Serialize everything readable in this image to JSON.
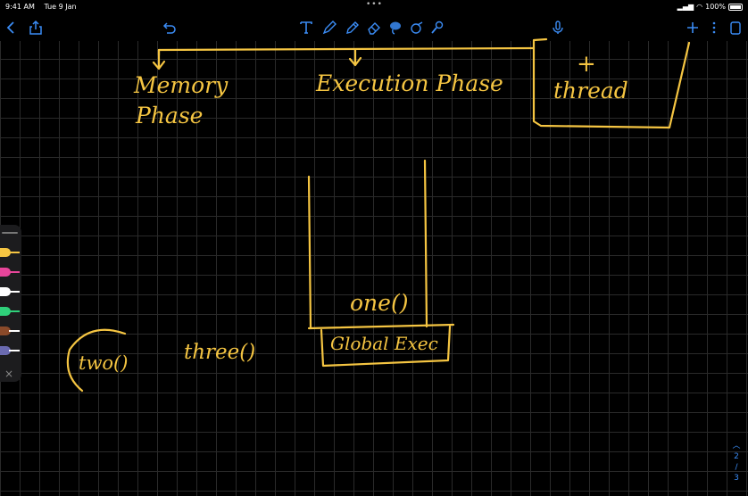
{
  "status": {
    "time": "9:41 AM",
    "date": "Tue 9 Jan",
    "battery": "100%"
  },
  "toolbar": {
    "left_icons": [
      "back-chevron-icon",
      "share-icon"
    ],
    "undo_icon": "undo-icon",
    "tools": [
      "text-tool-icon",
      "pen-tool-icon",
      "highlighter-tool-icon",
      "eraser-tool-icon",
      "lasso-tool-icon",
      "shape-tool-icon",
      "laser-pointer-icon"
    ],
    "right_icons": [
      "microphone-icon",
      "add-icon",
      "more-icon",
      "pages-icon"
    ],
    "accent": "#3b8cf5"
  },
  "notes": {
    "memory_phase_1": "Memory",
    "memory_phase_2": "Phase",
    "execution_phase": "Execution Phase",
    "plus": "+",
    "thread": "thread",
    "one": "one()",
    "global_exec": "Global Exec",
    "two": "two()",
    "three": "three()",
    "ink_color": "#f5c542"
  },
  "palette": {
    "pens": [
      {
        "color": "#f5c542"
      },
      {
        "color": "#e8459a"
      },
      {
        "color": "#ffffff"
      },
      {
        "color": "#2fd07a"
      },
      {
        "color": "#8a4a2a"
      },
      {
        "color": "#6a6ab0"
      }
    ],
    "close_icon": "×"
  },
  "pages": {
    "current": "2",
    "separator": "/",
    "total": "3"
  }
}
